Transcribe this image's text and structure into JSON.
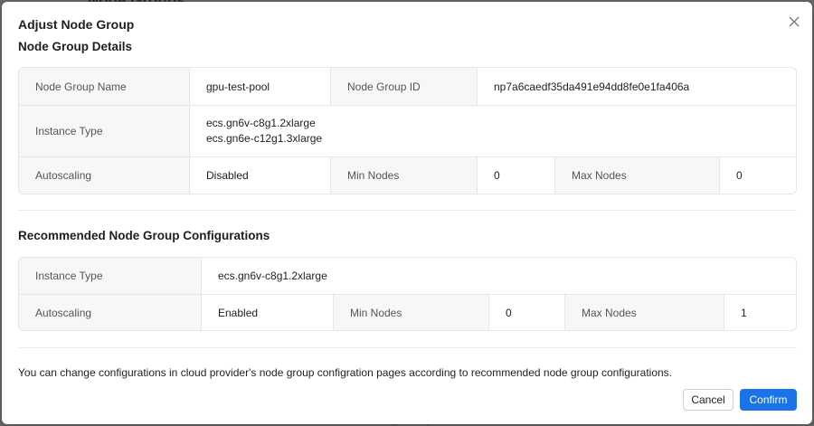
{
  "background": {
    "heading": "Node Groups",
    "fragment": "gpu-test-pool"
  },
  "modal": {
    "title": "Adjust Node Group",
    "close_icon": "close-icon"
  },
  "details": {
    "title": "Node Group Details",
    "name_label": "Node Group Name",
    "name_value": "gpu-test-pool",
    "id_label": "Node Group ID",
    "id_value": "np7a6caedf35da491e94dd8fe0e1fa406a",
    "instance_label": "Instance Type",
    "instance_values": [
      "ecs.gn6v-c8g1.2xlarge",
      "ecs.gn6e-c12g1.3xlarge"
    ],
    "autoscaling_label": "Autoscaling",
    "autoscaling_value": "Disabled",
    "min_label": "Min Nodes",
    "min_value": "0",
    "max_label": "Max Nodes",
    "max_value": "0"
  },
  "recommended": {
    "title": "Recommended Node Group Configurations",
    "instance_label": "Instance Type",
    "instance_value": "ecs.gn6v-c8g1.2xlarge",
    "autoscaling_label": "Autoscaling",
    "autoscaling_value": "Enabled",
    "min_label": "Min Nodes",
    "min_value": "0",
    "max_label": "Max Nodes",
    "max_value": "1"
  },
  "note": "You can change configurations in cloud provider's node group configration pages according to recommended node group configurations.",
  "buttons": {
    "cancel": "Cancel",
    "confirm": "Confirm"
  },
  "colors": {
    "accent": "#1a73e8"
  }
}
